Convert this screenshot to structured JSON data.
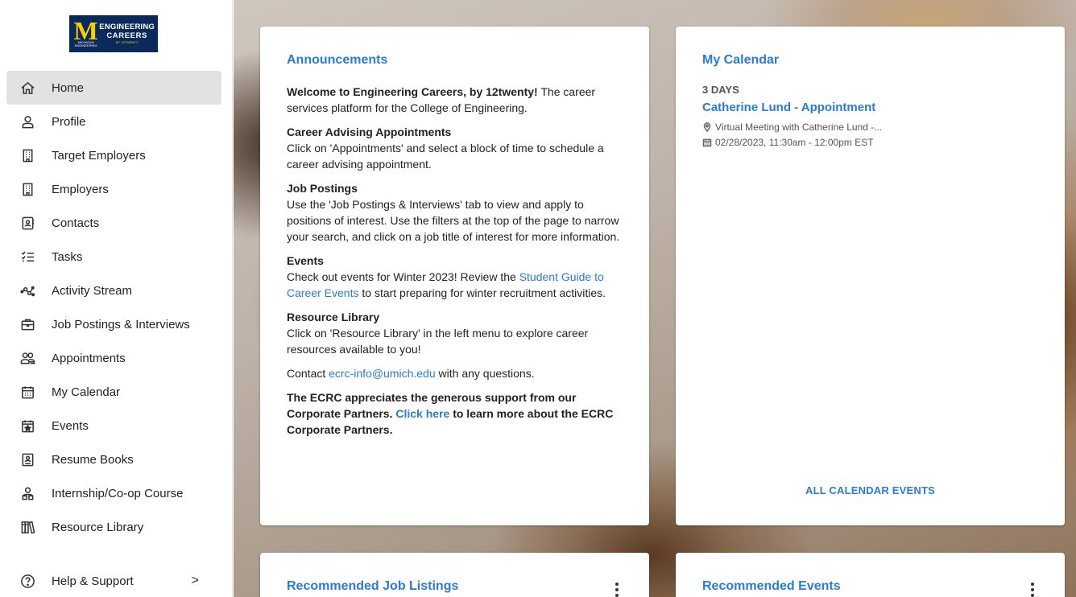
{
  "logo": {
    "line1": "ENGINEERING",
    "line2": "CAREERS",
    "m_letter": "M",
    "m_sub": "MICHIGAN ENGINEERING",
    "by": "BY 12TWENTY"
  },
  "sidebar": {
    "items": [
      {
        "label": "Home",
        "icon": "home-icon"
      },
      {
        "label": "Profile",
        "icon": "person-icon"
      },
      {
        "label": "Target Employers",
        "icon": "building-icon"
      },
      {
        "label": "Employers",
        "icon": "building-icon"
      },
      {
        "label": "Contacts",
        "icon": "contact-card-icon"
      },
      {
        "label": "Tasks",
        "icon": "checklist-icon"
      },
      {
        "label": "Activity Stream",
        "icon": "activity-icon"
      },
      {
        "label": "Job Postings & Interviews",
        "icon": "briefcase-icon"
      },
      {
        "label": "Appointments",
        "icon": "people-icon"
      },
      {
        "label": "My Calendar",
        "icon": "calendar-icon"
      },
      {
        "label": "Events",
        "icon": "event-star-icon"
      },
      {
        "label": "Resume Books",
        "icon": "resume-book-icon"
      },
      {
        "label": "Internship/Co-op Course",
        "icon": "course-icon"
      },
      {
        "label": "Resource Library",
        "icon": "library-icon"
      }
    ],
    "help": {
      "label": "Help & Support",
      "chevron": ">"
    }
  },
  "announcements": {
    "title": "Announcements",
    "welcome_bold": "Welcome to Engineering Careers, by 12twenty!",
    "welcome_rest": " The career services platform for the College of Engineering.",
    "advising_title": "Career Advising Appointments",
    "advising_text": "Click on 'Appointments' and select a block of time to schedule a career advising appointment.",
    "jobs_title": "Job Postings",
    "jobs_text": "Use the 'Job Postings & Interviews' tab to view and apply to positions of interest. Use the filters at the top of the page to narrow your search, and click on a job title of interest for more information.",
    "events_title": "Events",
    "events_text_before": "Check out events for Winter 2023! Review the ",
    "events_link": "Student Guide to Career Events",
    "events_text_after": " to start preparing for winter recruitment activities.",
    "library_title": "Resource Library",
    "library_text": "Click on 'Resource Library' in the left menu to explore career resources available to you!",
    "contact_before": "Contact ",
    "contact_email": "ecrc-info@umich.edu",
    "contact_after": " with any questions.",
    "partners_before": "The ECRC appreciates the generous support from our Corporate Partners. ",
    "partners_link": "Click here",
    "partners_after": " to learn more about the ECRC Corporate Partners."
  },
  "calendar": {
    "title": "My Calendar",
    "days": "3 DAYS",
    "event_title": "Catherine Lund - Appointment",
    "location": "Virtual Meeting with Catherine Lund -...",
    "datetime": "02/28/2023, 11:30am - 12:00pm EST",
    "all_link": "ALL CALENDAR EVENTS"
  },
  "recommended_jobs": {
    "title": "Recommended Job Listings"
  },
  "recommended_events": {
    "title": "Recommended Events"
  }
}
